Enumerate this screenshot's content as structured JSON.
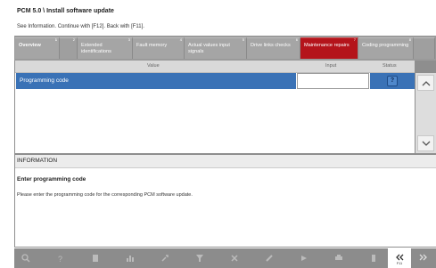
{
  "header": {
    "title": "PCM 5.0 \\ Install software update",
    "instruction": "See Information. Continue with [F12]. Back with [F11]."
  },
  "tabs": [
    {
      "label": "Overview",
      "num": "1"
    },
    {
      "label": "",
      "num": "2"
    },
    {
      "label": "Extended identifications",
      "num": "3"
    },
    {
      "label": "Fault memory",
      "num": "4"
    },
    {
      "label": "Actual values input signals",
      "num": "5"
    },
    {
      "label": "Drive links checks",
      "num": "6"
    },
    {
      "label": "Maintenance repairs",
      "num": "7"
    },
    {
      "label": "Coding programming",
      "num": "8"
    },
    {
      "label": "",
      "num": ""
    }
  ],
  "table": {
    "headers": {
      "value": "Value",
      "input": "Input",
      "status": "Status"
    },
    "rows": [
      {
        "value": "Programming code",
        "input": "",
        "status_icon": "question-icon",
        "status_glyph": "?"
      }
    ]
  },
  "info": {
    "heading": "INFORMATION",
    "subheading": "Enter programming code",
    "text": "Please enter the programming code for the corresponding PCM software update."
  },
  "bottom_bar": {
    "items": [
      {
        "icon": "search-icon"
      },
      {
        "icon": "help-icon",
        "glyph": "?"
      },
      {
        "icon": "document-icon"
      },
      {
        "icon": "chart-icon"
      },
      {
        "icon": "wrench-icon"
      },
      {
        "icon": "filter-icon"
      },
      {
        "icon": "tools-icon"
      },
      {
        "icon": "edit-icon"
      },
      {
        "icon": "forward-icon"
      },
      {
        "icon": "print-icon"
      },
      {
        "icon": "battery-icon"
      },
      {
        "icon": "back-icon",
        "label": "F11"
      },
      {
        "icon": "next-icon"
      }
    ]
  },
  "colors": {
    "accent": "#b4141b",
    "selection": "#3a72b6",
    "frame": "#8e8e8e"
  }
}
